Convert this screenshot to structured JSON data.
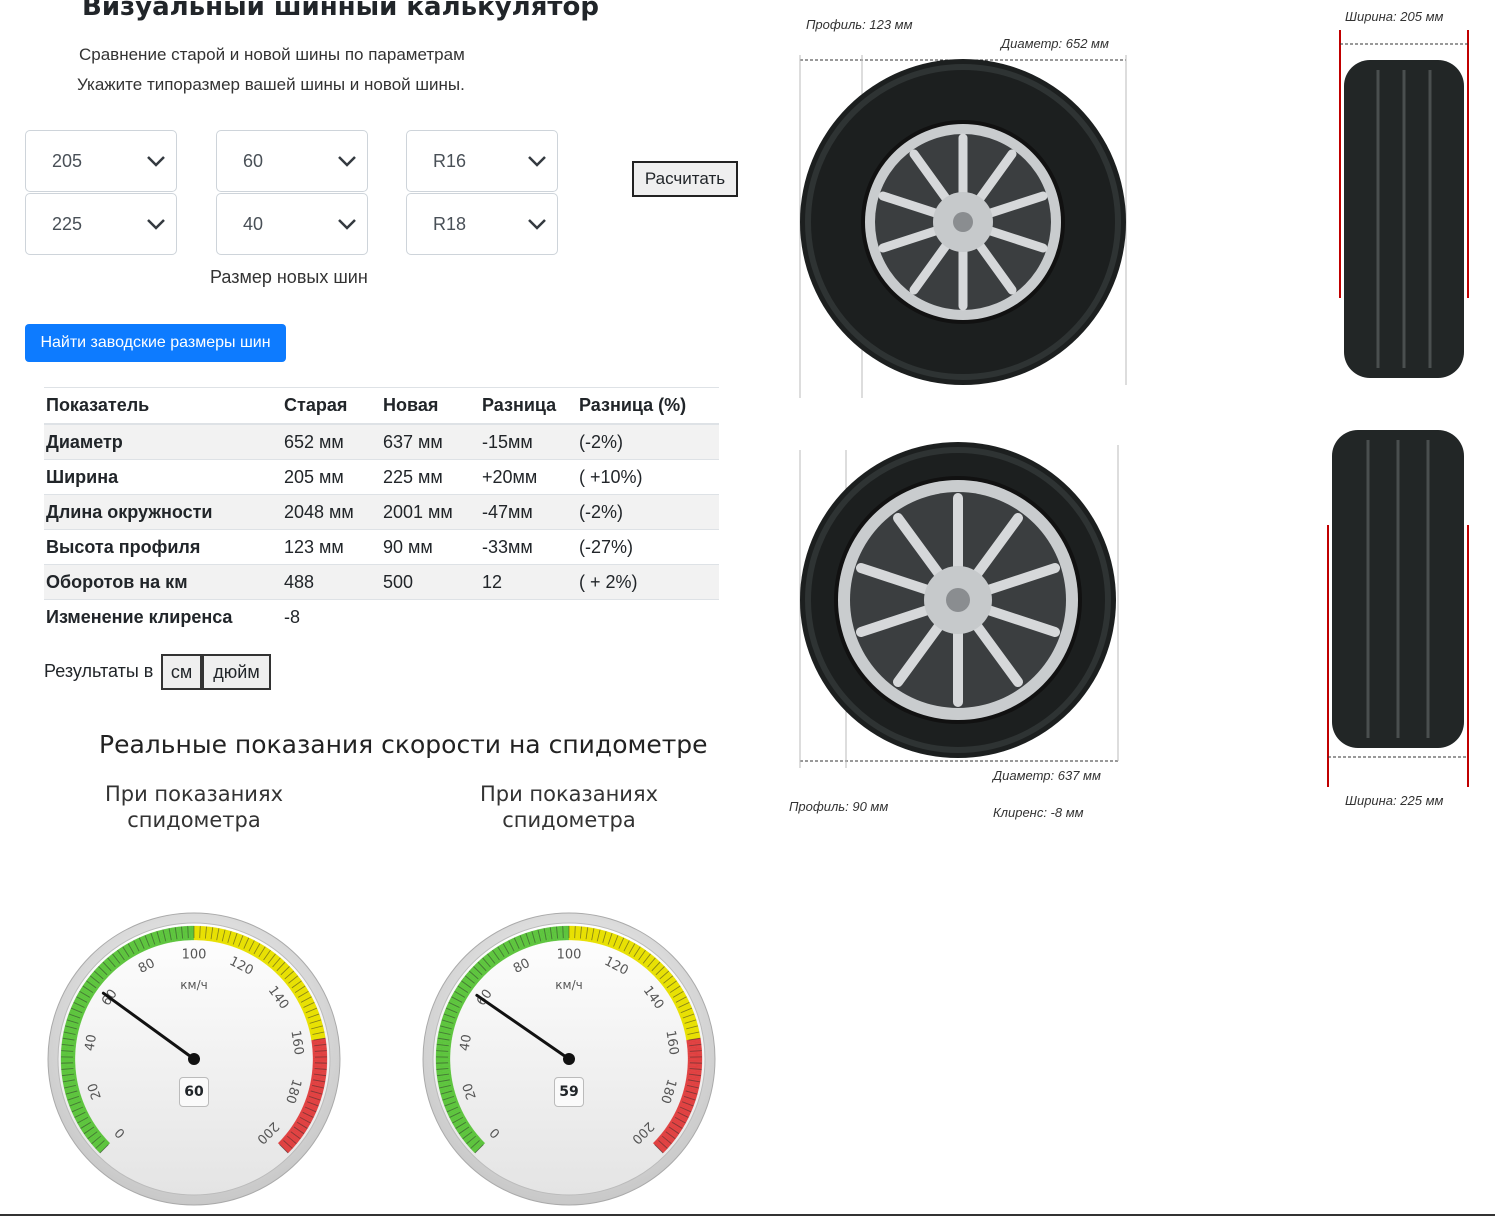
{
  "header": {
    "title": "Визуальный шинный калькулятор",
    "subtitle1": "Сравнение старой и новой шины по параметрам",
    "subtitle2": "Укажите типоразмер вашей шины и новой шины."
  },
  "selects": {
    "old": {
      "width": "205",
      "profile": "60",
      "radius": "R16"
    },
    "new": {
      "width": "225",
      "profile": "40",
      "radius": "R18"
    },
    "new_caption": "Размер новых шин"
  },
  "buttons": {
    "calculate": "Расчитать",
    "find_factory": "Найти заводские размеры шин"
  },
  "table": {
    "headers": [
      "Показатель",
      "Старая",
      "Новая",
      "Разница",
      "Разница (%)"
    ],
    "rows": [
      [
        "Диаметр",
        "652 мм",
        "637 мм",
        "-15мм",
        "(-2%)"
      ],
      [
        "Ширина",
        "205 мм",
        "225 мм",
        "+20мм",
        "( +10%)"
      ],
      [
        "Длина окружности",
        "2048 мм",
        "2001 мм",
        "-47мм",
        "(-2%)"
      ],
      [
        "Высота профиля",
        "123 мм",
        "90 мм",
        "-33мм",
        "(-27%)"
      ],
      [
        "Оборотов на км",
        "488",
        "500",
        "12",
        "( + 2%)"
      ],
      [
        "Изменение клиренса",
        "-8",
        "",
        "",
        ""
      ]
    ]
  },
  "units": {
    "label": "Результаты в",
    "cm": "см",
    "inch": "дюйм"
  },
  "speedometer": {
    "title": "Реальные показания скорости на спидометре",
    "caption": "При показаниях спидометра",
    "unit": "км/ч",
    "ticks": [
      "0",
      "20",
      "40",
      "60",
      "80",
      "100",
      "120",
      "140",
      "160",
      "180",
      "200"
    ],
    "gauges": [
      {
        "needle_value": 60,
        "display": "60"
      },
      {
        "needle_value": 59,
        "display": "59"
      }
    ],
    "colors": {
      "green": "#5cc43c",
      "yellow": "#e8e000",
      "red": "#e04040"
    }
  },
  "diagram": {
    "old": {
      "profile": "Профиль: 123 мм",
      "diameter": "Диаметр: 652 мм",
      "width": "Ширина: 205 мм"
    },
    "new": {
      "profile": "Профиль: 90 мм",
      "diameter": "Диаметр: 637 мм",
      "clearance": "Клиренс: -8 мм",
      "width": "Ширина: 225 мм"
    }
  }
}
